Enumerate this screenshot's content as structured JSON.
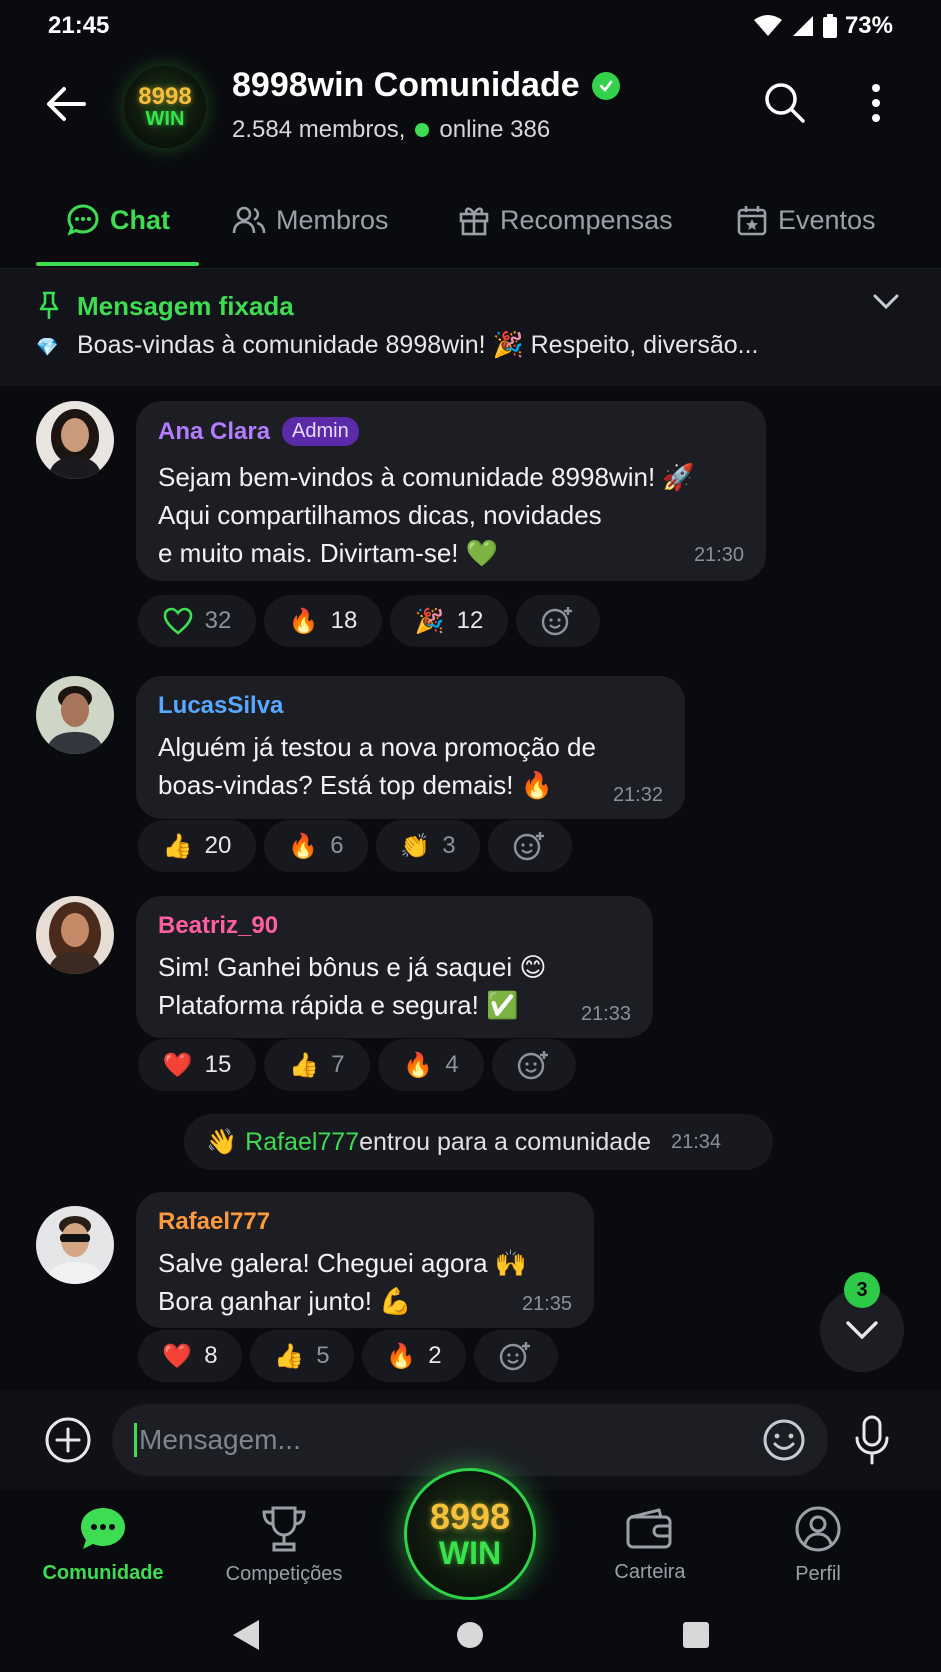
{
  "status_bar": {
    "time": "21:45",
    "battery": "73%"
  },
  "header": {
    "logo_top": "8998",
    "logo_bottom": "WIN",
    "title": "8998win Comunidade",
    "members": "2.584 membros,",
    "online": "online 386"
  },
  "tabs": [
    {
      "label": "Chat",
      "icon": "chat-bubble-icon"
    },
    {
      "label": "Membros",
      "icon": "people-icon"
    },
    {
      "label": "Recompensas",
      "icon": "gift-icon"
    },
    {
      "label": "Eventos",
      "icon": "calendar-star-icon"
    }
  ],
  "pinned": {
    "title": "Mensagem fixada",
    "text": "Boas-vindas à comunidade 8998win! 🎉  Respeito, diversão..."
  },
  "messages": [
    {
      "name": "Ana Clara",
      "badge": "Admin",
      "lines": [
        "Sejam bem-vindos à comunidade 8998win! 🚀",
        "Aqui compartilhamos dicas, novidades",
        "e muito mais. Divirtam-se! 💚"
      ],
      "time": "21:30",
      "reactions": [
        {
          "emoji": "♡",
          "count": "32"
        },
        {
          "emoji": "🔥",
          "count": "18"
        },
        {
          "emoji": "🎉",
          "count": "12"
        }
      ]
    },
    {
      "name": "LucasSilva",
      "lines": [
        "Alguém já testou a nova promoção de",
        "boas-vindas? Está top demais! 🔥"
      ],
      "time": "21:32",
      "reactions": [
        {
          "emoji": "👍",
          "count": "20"
        },
        {
          "emoji": "🔥",
          "count": "6"
        },
        {
          "emoji": "👏",
          "count": "3"
        }
      ]
    },
    {
      "name": "Beatriz_90",
      "lines": [
        "Sim! Ganhei bônus e já saquei 😊",
        "Plataforma rápida e segura! ✅"
      ],
      "time": "21:33",
      "reactions": [
        {
          "emoji": "❤️",
          "count": "15"
        },
        {
          "emoji": "👍",
          "count": "7"
        },
        {
          "emoji": "🔥",
          "count": "4"
        }
      ]
    },
    {
      "name": "Rafael777",
      "lines": [
        "Salve galera! Cheguei agora 🙌",
        "Bora ganhar junto! 💪"
      ],
      "time": "21:35",
      "reactions": [
        {
          "emoji": "❤️",
          "count": "8"
        },
        {
          "emoji": "👍",
          "count": "5"
        },
        {
          "emoji": "🔥",
          "count": "2"
        }
      ]
    }
  ],
  "system_message": {
    "emoji": "👋",
    "user": "Rafael777",
    "text": " entrou para a comunidade",
    "time": "21:34"
  },
  "scroll_badge": "3",
  "input": {
    "placeholder": "Mensagem..."
  },
  "bottom_nav": [
    {
      "label": "Comunidade"
    },
    {
      "label": "Competições"
    },
    {
      "label": "Carteira"
    },
    {
      "label": "Perfil"
    }
  ],
  "colors": {
    "accent": "#3ddc52",
    "admin_name": "#b27cff",
    "lucas_name": "#58a8ff",
    "beatriz_name": "#ff5fa2",
    "rafael_name": "#ff9a3c"
  }
}
